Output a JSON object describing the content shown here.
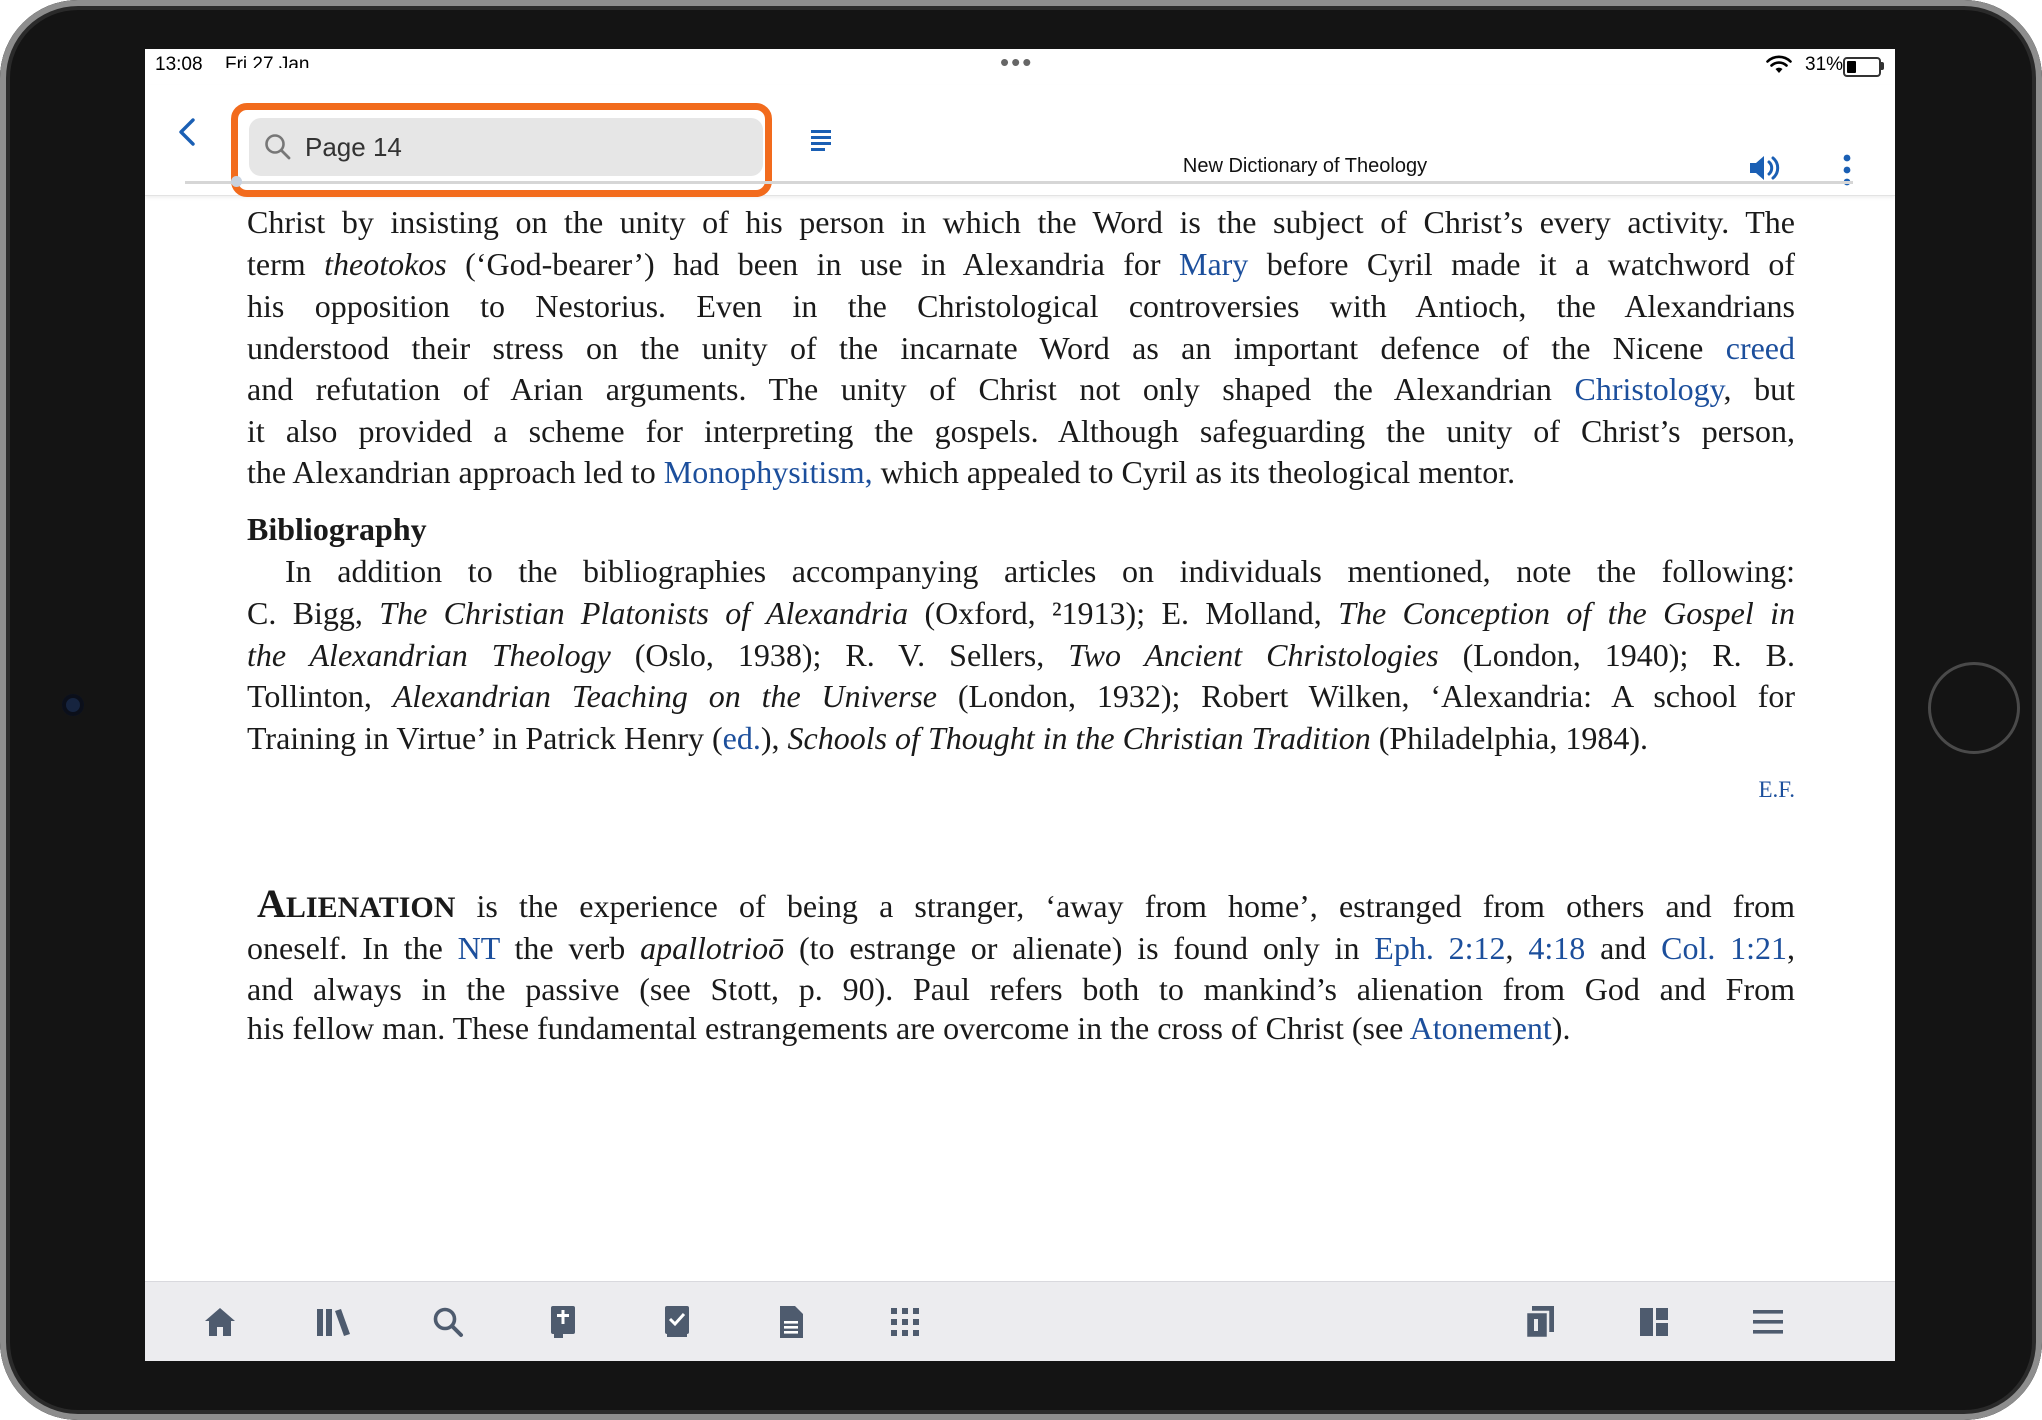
{
  "status": {
    "time": "13:08",
    "date": "Fri 27 Jan",
    "battery_percent": "31%",
    "battery_level": 0.31
  },
  "toolbar": {
    "search_value": "Page 14",
    "title": "New Dictionary of Theology"
  },
  "article": {
    "p1": {
      "l1": "Christ by insisting on the unity of his person in which the Word is the subject of Christ’s every activity. The",
      "l2_a": "term ",
      "l2_em": "theotokos",
      "l2_b": " (‘God-bearer’) had been in use in Alexandria for ",
      "l2_link": "Mary",
      "l2_c": " before Cyril made it a watchword of",
      "l3": "his opposition to Nestorius. Even in the Christological controversies with Antioch, the Alexandrians",
      "l4_a": "understood their stress on the unity of the incarnate Word as an important defence of the Nicene ",
      "l4_link": "creed",
      "l5_a": "and refutation of Arian arguments. The unity of Christ not only shaped the Alexandrian ",
      "l5_link": "Christology",
      "l5_b": ", but",
      "l6": "it also provided a scheme for interpreting the gospels. Although safeguarding the unity of Christ’s person,",
      "l7_a": "the Alexandrian approach led to ",
      "l7_link": "Monophysitism,",
      "l7_b": " which appealed to Cyril as its theological mentor."
    },
    "bibliography_heading": "Bibliography",
    "bib": {
      "l1": "In addition to the bibliographies accompanying articles on individuals mentioned, note the following:",
      "l2_a": "C. Bigg, ",
      "l2_em1": "The Christian Platonists of Alexandria",
      "l2_b": " (Oxford, ²1913); E. Molland, ",
      "l2_em2": "The Conception of the Gospel in",
      "l3_em1": "the Alexandrian Theology",
      "l3_b": " (Oslo, 1938); R. V. Sellers, ",
      "l3_em2": "Two Ancient Christologies",
      "l3_c": " (London, 1940); R. B.",
      "l4_a": "Tollinton, ",
      "l4_em": "Alexandrian Teaching on the Universe",
      "l4_b": " (London, 1932); Robert Wilken, ‘Alexandria: A school for",
      "l5_a": "Training in Virtue’ in Patrick Henry (",
      "l5_link": "ed.",
      "l5_b": "), ",
      "l5_em": "Schools of Thought in the Christian Tradition",
      "l5_c": " (Philadelphia, 1984)."
    },
    "author_initials": "E.F.",
    "p2": {
      "lemma_cap": "A",
      "lemma_rest": "LIENATION",
      "l1_rest": " is the experience of being a stranger, ‘away from home’, estranged from others and from",
      "l2_a": "oneself. In the ",
      "l2_link1": "NT",
      "l2_b": " the verb ",
      "l2_em": "apallotrioō",
      "l2_c": " (to estrange or alienate) is found only in ",
      "l2_link2": "Eph. 2:12",
      "l2_d": ", ",
      "l2_link3": "4:18",
      "l2_e": " and ",
      "l2_link4": "Col. 1:21",
      "l2_f": ",",
      "l3": "and always in the passive (see Stott, p. 90). Paul refers both to mankind’s alienation from God and From",
      "l4_a": "his fellow man. These fundamental estrangements are overcome in the cross of Christ (see ",
      "l4_link": "Atonement",
      "l4_b": ")."
    }
  },
  "tabbar": {
    "icons": [
      "home-icon",
      "library-icon",
      "search-icon",
      "bible-icon",
      "tasks-icon",
      "document-icon",
      "apps-grid-icon",
      "layouts-icon",
      "panels-icon",
      "menu-icon"
    ]
  },
  "colors": {
    "link": "#1c4f9c",
    "accent": "#1a5fb4",
    "highlight": "#f26b1d"
  }
}
